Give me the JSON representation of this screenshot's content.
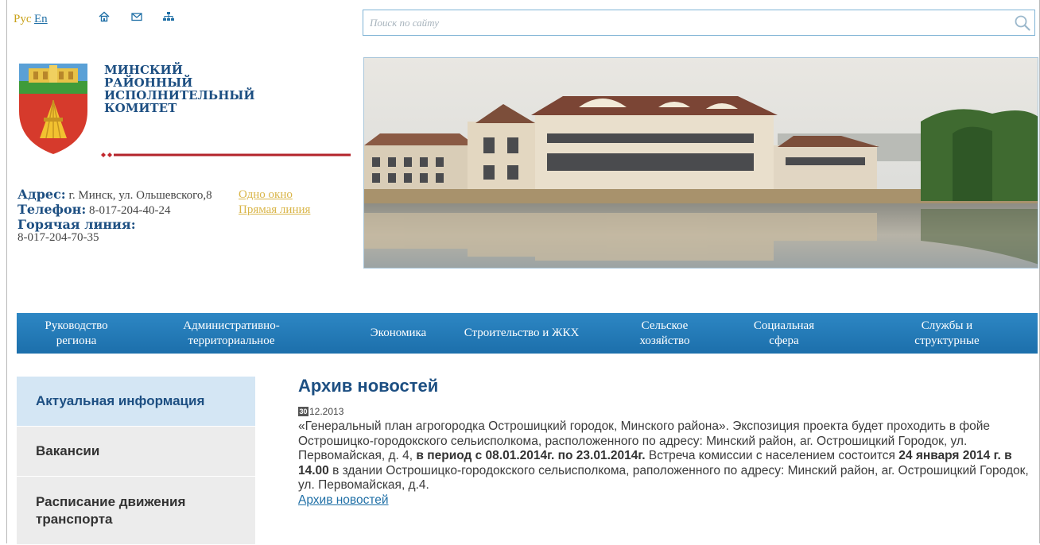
{
  "top_bar": {
    "lang_ru": "Рус",
    "lang_en": "En",
    "icons": [
      "home-icon",
      "mail-icon",
      "sitemap-icon"
    ]
  },
  "search": {
    "placeholder": "Поиск по сайту",
    "icon": "search-icon"
  },
  "organization": {
    "line1": "МИНСКИЙ",
    "line2": "РАЙОННЫЙ",
    "line3": "ИСПОЛНИТЕЛЬНЫЙ",
    "line4": "КОМИТЕТ"
  },
  "contacts": {
    "address_label": "Адрес:",
    "address_value": "г. Минск, ул. Ольшевского,8",
    "phone_label": "Телефон:",
    "phone_value": "8-017-204-40-24",
    "hotline_label": "Горячая линия:",
    "hotline_value": "8-017-204-70-35"
  },
  "quick_links": {
    "one_window": "Одно окно",
    "direct_line": "Прямая линия"
  },
  "nav": {
    "items": [
      {
        "label": "Руководство региона"
      },
      {
        "label": "Административно-территориальное"
      },
      {
        "label": "Экономика"
      },
      {
        "label": "Строительство и ЖКХ"
      },
      {
        "label": "Сельское хозяйство"
      },
      {
        "label": "Социальная сфера"
      },
      {
        "label": "Службы и структурные"
      }
    ]
  },
  "sidebar": {
    "items": [
      {
        "label": "Актуальная информация"
      },
      {
        "label": "Вакансии"
      },
      {
        "label": "Расписание движения транспорта"
      }
    ]
  },
  "main": {
    "title": "Архив новостей",
    "date_day": "30",
    "date_rest": "12.2013",
    "p1": "«Генеральный план агрогородка Острошицкий городок, Минского района». Экспозиция проекта будет проходить в фойе Острошицко-городокского сельисполкома, расположенного по адресу: Минский район, аг. Острошицкий Городок, ул. Первомайская, д. 4,",
    "p1_bold": "в период с 08.01.2014г. по 23.01.2014г.",
    "p2": "Встреча комиссии с населением состоится",
    "p2_bold": "24 января 2014 г. в 14.00",
    "p3": "в здании Острошицко-городокского сельисполкома, раположенного по адресу: Минский район, аг. Острошицкий Городок, ул. Первомайская, д.4.",
    "archive_link": "Архив новостей"
  },
  "colors": {
    "brand_blue": "#1d4f82",
    "nav_blue": "#2a82c0",
    "link_gold": "#d9b548",
    "sidebar_active": "#d4e6f4",
    "sidebar_bg": "#ececec"
  }
}
